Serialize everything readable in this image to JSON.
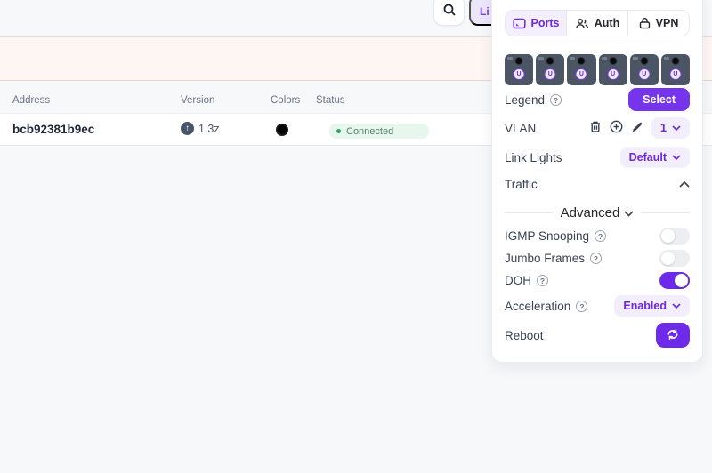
{
  "topbar": {
    "li_button_label": "Li"
  },
  "banner": {
    "bg": "#fdf6f3",
    "border": "#e9d4cc"
  },
  "table": {
    "columns": [
      "Address",
      "Version",
      "Colors",
      "Status"
    ],
    "rows": [
      {
        "address": "bcb92381b9ec",
        "version": "1.3z",
        "update_available": true,
        "color_swatch": "#000000",
        "status": "Connected",
        "status_color": "#2fa866"
      }
    ]
  },
  "panel": {
    "tabs": [
      {
        "label": "Ports",
        "active": true
      },
      {
        "label": "Auth",
        "active": false
      },
      {
        "label": "VPN",
        "active": false
      }
    ],
    "ports": [
      {
        "badge": "U",
        "led": "black"
      },
      {
        "badge": "U",
        "led": "black"
      },
      {
        "badge": "U",
        "led": "black"
      },
      {
        "badge": "U",
        "led": "black"
      },
      {
        "badge": "U",
        "led": "black"
      },
      {
        "badge": "U",
        "led": "black"
      }
    ],
    "legend": {
      "label": "Legend",
      "button": "Select"
    },
    "vlan": {
      "label": "VLAN",
      "value": "1"
    },
    "link_lights": {
      "label": "Link Lights",
      "value": "Default"
    },
    "traffic": {
      "label": "Traffic",
      "expanded": true
    },
    "advanced": {
      "label": "Advanced"
    },
    "igmp": {
      "label": "IGMP Snooping",
      "enabled": false
    },
    "jumbo": {
      "label": "Jumbo Frames",
      "enabled": false
    },
    "doh": {
      "label": "DOH",
      "enabled": true
    },
    "acceleration": {
      "label": "Acceleration",
      "value": "Enabled"
    },
    "reboot": {
      "label": "Reboot"
    }
  },
  "icons": {
    "help": "?",
    "update_arrow": "↑"
  },
  "colors": {
    "accent": "#7634eb",
    "accent_dark": "#6d2ae8",
    "accent_text": "#6d28d9",
    "accent_light_bg": "#f2eefb",
    "toggle_off": "#eceef2",
    "status_pill_bg": "#e7f7ee",
    "port_tile": "#4b5563",
    "page_bg": "#f7f8fa"
  }
}
